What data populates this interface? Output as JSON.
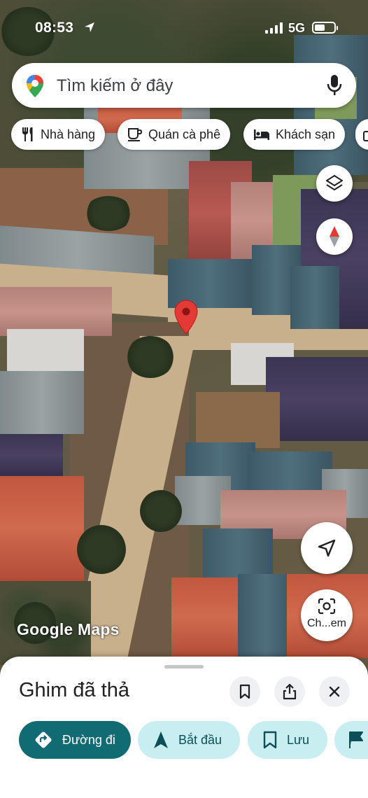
{
  "status_bar": {
    "time": "08:53",
    "network": "5G",
    "battery_level": 0.55
  },
  "search": {
    "placeholder": "Tìm kiếm ở đây"
  },
  "chips": [
    {
      "label": "Nhà hàng",
      "icon": "restaurant-icon"
    },
    {
      "label": "Quán cà phê",
      "icon": "coffee-icon"
    },
    {
      "label": "Khách sạn",
      "icon": "hotel-icon"
    }
  ],
  "map": {
    "layers_icon": "layers-icon",
    "compass_icon": "compass-icon",
    "recenter_icon": "navigation-arrow-icon",
    "lens_label": "Ch...em",
    "watermark": "Google Maps"
  },
  "sheet": {
    "title": "Ghim đã thả",
    "actions": [
      {
        "label": "Đường đi",
        "icon": "directions-icon"
      },
      {
        "label": "Bắt đầu",
        "icon": "navigation-icon"
      },
      {
        "label": "Lưu",
        "icon": "bookmark-icon"
      }
    ]
  },
  "colors": {
    "primary": "#106b73",
    "secondary": "#c9eef2",
    "pin": "#e53935"
  }
}
